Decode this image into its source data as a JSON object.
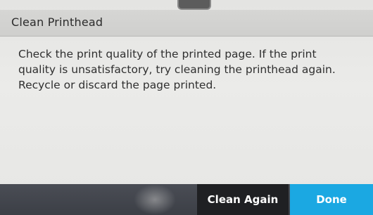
{
  "dialog": {
    "title": "Clean Printhead",
    "message": "Check the print quality of the printed page. If the print quality is unsatisfactory, try cleaning the printhead again. Recycle or discard the page printed."
  },
  "buttons": {
    "clean_again_label": "Clean Again",
    "done_label": "Done"
  },
  "colors": {
    "done_accent": "#1ba8e2",
    "clean_again_bg": "#1f2023",
    "title_bar_bg": "#d2d2d0",
    "content_bg": "#e8e8e6"
  }
}
